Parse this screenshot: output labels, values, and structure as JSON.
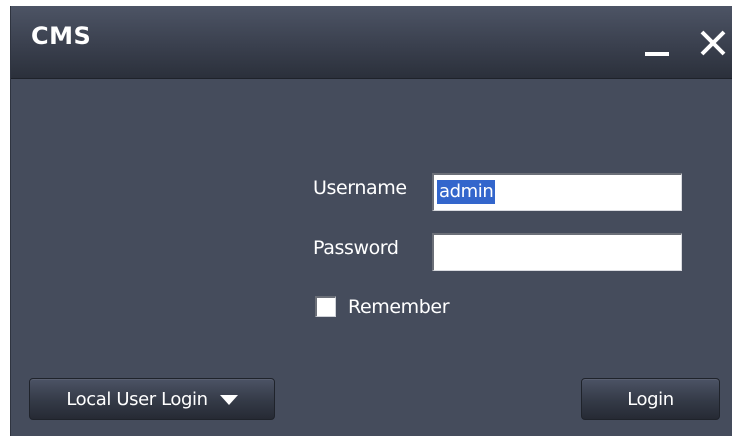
{
  "window": {
    "title": "CMS",
    "minimize_icon": "minimize-icon",
    "close_icon": "close-icon"
  },
  "form": {
    "username_label": "Username",
    "username_value": "admin",
    "password_label": "Password",
    "password_value": "",
    "remember_label": "Remember",
    "remember_checked": false
  },
  "footer": {
    "login_mode_label": "Local User Login",
    "login_mode_icon": "caret-down-icon",
    "login_button_label": "Login"
  },
  "colors": {
    "window_bg": "#454c5c",
    "selection": "#3366cc",
    "text": "#ffffff"
  }
}
